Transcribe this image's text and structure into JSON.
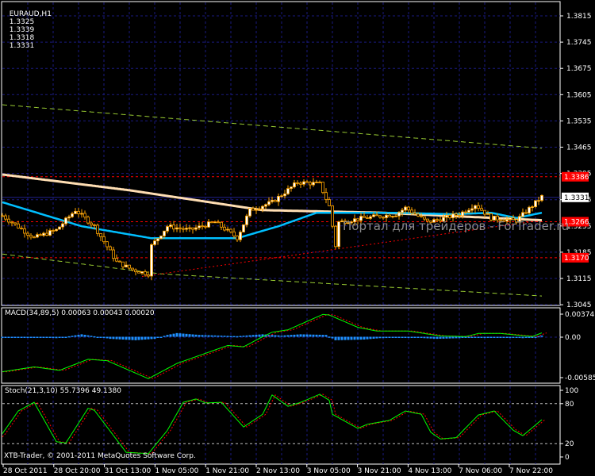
{
  "header": {
    "symbol": "EURAUD,H1",
    "open": "1.3325",
    "high": "1.3339",
    "low": "1.3318",
    "close": "1.3331"
  },
  "watermark": "Портал для трейдеров - ForTrader.ru",
  "copyright": "XTB-Trader, © 2001-2011 MetaQuotes Software Corp.",
  "price_axis": [
    "1.3815",
    "1.3745",
    "1.3675",
    "1.3605",
    "1.3535",
    "1.3465",
    "1.3395",
    "1.3325",
    "1.3255",
    "1.3185",
    "1.3115",
    "1.3045"
  ],
  "price_labels": [
    {
      "text": "1.3386",
      "value": 1.3386,
      "color": "#ff0000"
    },
    {
      "text": "1.3331",
      "value": 1.3331,
      "color": "#ffffff"
    },
    {
      "text": "1.3266",
      "value": 1.3266,
      "color": "#ff0000"
    },
    {
      "text": "1.3170",
      "value": 1.317,
      "color": "#ff0000"
    }
  ],
  "time_axis": [
    "28 Oct 2011",
    "28 Oct 20:00",
    "31 Oct 13:00",
    "1 Nov 05:00",
    "1 Nov 21:00",
    "2 Nov 13:00",
    "3 Nov 05:00",
    "3 Nov 21:00",
    "4 Nov 13:00",
    "7 Nov 06:00",
    "7 Nov 22:00"
  ],
  "macd": {
    "label": "MACD(34,89,5) 0.00063 0.00043 0.00020",
    "axis": [
      "0.00374",
      "0.00",
      "-0.00585"
    ]
  },
  "stoch": {
    "label": "Stoch(21,3,10) 55.7396 49.1380",
    "axis": [
      "100",
      "80",
      "20",
      "0"
    ]
  },
  "colors": {
    "candle": "#ffa500",
    "ma_slow": "#ffdeb3",
    "ma_fast": "#00bfff",
    "envelope": "#9acd32",
    "level": "#ff0000",
    "grid": "#1a1a80",
    "signal": "#ff0000",
    "main": "#00ff00",
    "hist": "#1e90ff"
  },
  "chart_data": {
    "type": "line",
    "price_range": [
      1.3045,
      1.3815
    ],
    "close_keypoints": [
      [
        0,
        1.3282
      ],
      [
        10,
        1.3223
      ],
      [
        17,
        1.3244
      ],
      [
        23,
        1.3297
      ],
      [
        29,
        1.3254
      ],
      [
        36,
        1.3159
      ],
      [
        41,
        1.3138
      ],
      [
        46,
        1.3127
      ],
      [
        47,
        1.3202
      ],
      [
        52,
        1.3254
      ],
      [
        59,
        1.3244
      ],
      [
        67,
        1.3265
      ],
      [
        74,
        1.3223
      ],
      [
        78,
        1.3297
      ],
      [
        85,
        1.3318
      ],
      [
        93,
        1.3371
      ],
      [
        100,
        1.3367
      ],
      [
        103,
        1.3307
      ],
      [
        105,
        1.3202
      ],
      [
        106,
        1.3265
      ],
      [
        114,
        1.3276
      ],
      [
        124,
        1.3286
      ],
      [
        127,
        1.3303
      ],
      [
        134,
        1.3265
      ],
      [
        144,
        1.3286
      ],
      [
        149,
        1.3312
      ],
      [
        154,
        1.3276
      ],
      [
        162,
        1.3269
      ],
      [
        170,
        1.3333
      ]
    ],
    "ma_slow": [
      [
        0,
        1.3392
      ],
      [
        40,
        1.335
      ],
      [
        82,
        1.3297
      ],
      [
        120,
        1.329
      ],
      [
        170,
        1.327
      ]
    ],
    "ma_fast": [
      [
        0,
        1.3318
      ],
      [
        25,
        1.3254
      ],
      [
        47,
        1.3222
      ],
      [
        74,
        1.3222
      ],
      [
        87,
        1.3254
      ],
      [
        99,
        1.329
      ],
      [
        124,
        1.329
      ],
      [
        142,
        1.3286
      ],
      [
        154,
        1.329
      ],
      [
        162,
        1.3276
      ],
      [
        170,
        1.329
      ]
    ],
    "envelope_upper": [
      [
        0,
        1.3578
      ],
      [
        170,
        1.3462
      ]
    ],
    "envelope_lower": [
      [
        0,
        1.318
      ],
      [
        50,
        1.3127
      ],
      [
        170,
        1.3068
      ]
    ],
    "trendline": [
      [
        44,
        1.312
      ],
      [
        170,
        1.327
      ]
    ],
    "levels": [
      1.3386,
      1.3266,
      1.317
    ],
    "macd_range": [
      -0.00585,
      0.00374
    ],
    "macd_main": [
      [
        0,
        -0.005
      ],
      [
        10,
        -0.0043
      ],
      [
        18,
        -0.0048
      ],
      [
        27,
        -0.0032
      ],
      [
        33,
        -0.0034
      ],
      [
        46,
        -0.006
      ],
      [
        55,
        -0.0038
      ],
      [
        71,
        -0.0012
      ],
      [
        76,
        -0.0014
      ],
      [
        85,
        0.0008
      ],
      [
        90,
        0.0012
      ],
      [
        101,
        0.0037
      ],
      [
        103,
        0.0036
      ],
      [
        112,
        0.0016
      ],
      [
        118,
        0.001
      ],
      [
        128,
        0.001
      ],
      [
        138,
        0.0002
      ],
      [
        146,
        0.0001
      ],
      [
        150,
        0.0006
      ],
      [
        157,
        0.0006
      ],
      [
        167,
        0.0001
      ],
      [
        170,
        0.0007
      ]
    ],
    "macd_hist": [
      [
        0,
        0
      ],
      [
        13,
        0
      ],
      [
        17,
        -0.0002
      ],
      [
        20,
        0
      ],
      [
        25,
        0.0004
      ],
      [
        30,
        0
      ],
      [
        34,
        -0.0003
      ],
      [
        42,
        -0.0005
      ],
      [
        48,
        -0.0003
      ],
      [
        52,
        0.0003
      ],
      [
        55,
        0.0006
      ],
      [
        62,
        0.0003
      ],
      [
        74,
        0.0001
      ],
      [
        82,
        0.0004
      ],
      [
        88,
        0.0002
      ],
      [
        94,
        0.0004
      ],
      [
        102,
        0.0003
      ],
      [
        105,
        -0.0005
      ],
      [
        114,
        -0.0004
      ],
      [
        119,
        -0.0002
      ],
      [
        129,
        -0.0001
      ],
      [
        137,
        -0.0003
      ],
      [
        144,
        -0.0002
      ],
      [
        149,
        0
      ],
      [
        159,
        0
      ],
      [
        164,
        -0.0002
      ],
      [
        168,
        0
      ],
      [
        170,
        0.0002
      ]
    ],
    "stoch_main": [
      [
        0,
        35
      ],
      [
        5,
        69
      ],
      [
        10,
        82
      ],
      [
        17,
        23
      ],
      [
        20,
        21
      ],
      [
        27,
        73
      ],
      [
        29,
        70
      ],
      [
        39,
        7
      ],
      [
        46,
        5
      ],
      [
        52,
        40
      ],
      [
        57,
        82
      ],
      [
        61,
        87
      ],
      [
        64,
        81
      ],
      [
        69,
        82
      ],
      [
        76,
        45
      ],
      [
        82,
        64
      ],
      [
        85,
        93
      ],
      [
        90,
        76
      ],
      [
        94,
        82
      ],
      [
        100,
        94
      ],
      [
        103,
        85
      ],
      [
        104,
        64
      ],
      [
        112,
        43
      ],
      [
        115,
        49
      ],
      [
        122,
        55
      ],
      [
        127,
        69
      ],
      [
        132,
        64
      ],
      [
        135,
        37
      ],
      [
        138,
        27
      ],
      [
        143,
        29
      ],
      [
        150,
        63
      ],
      [
        155,
        69
      ],
      [
        161,
        40
      ],
      [
        164,
        32
      ],
      [
        170,
        56
      ]
    ],
    "stoch_levels": [
      80,
      20
    ]
  }
}
